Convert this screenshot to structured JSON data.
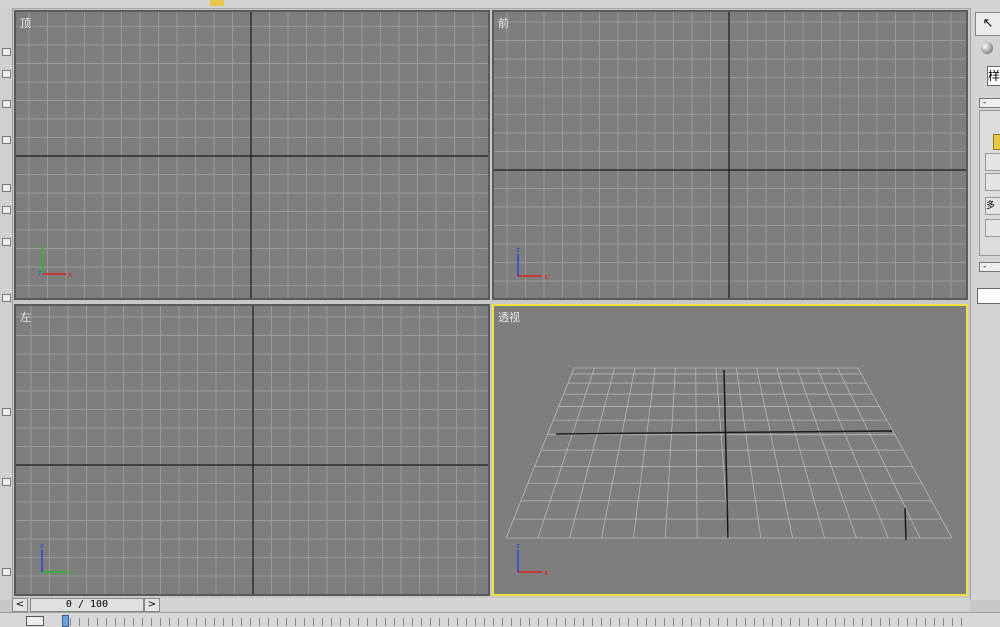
{
  "viewports": {
    "top": {
      "label": "顶"
    },
    "front": {
      "label": "前"
    },
    "left": {
      "label": "左"
    },
    "perspective": {
      "label": "透视"
    }
  },
  "axes": {
    "x": "x",
    "y": "y",
    "z": "z"
  },
  "command_panel": {
    "field_text": "样",
    "rollout_collapse": "-",
    "button_text": "多",
    "second_rollout_collapse": "-"
  },
  "timeline": {
    "frame_display": "0 / 100",
    "prev_label": "<",
    "next_label": ">"
  },
  "colors": {
    "viewport_bg": "#7f7e7e",
    "grid": "#9a9a9a",
    "axis_line": "#1a1a1a",
    "active_border": "#f0e040",
    "axis_x": "#d82020",
    "axis_y": "#20c020",
    "axis_z": "#2040e0"
  }
}
